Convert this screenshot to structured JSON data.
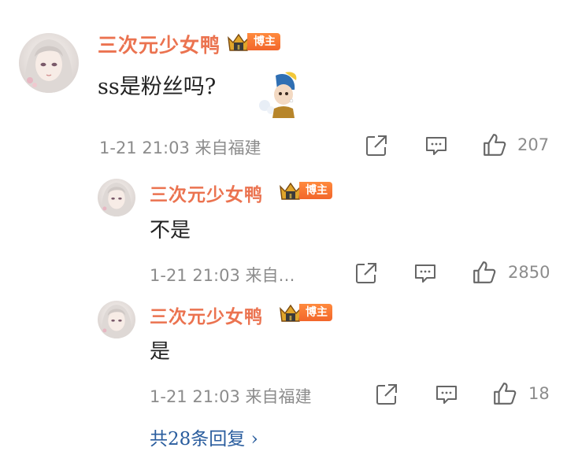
{
  "comments": [
    {
      "username": "三次元少女鸭",
      "badge": "博主",
      "text": "ss是粉丝吗?",
      "meta": "1-21 21:03 来自福建",
      "likes": "207",
      "sticker": "girl-with-pearl-earring-sticker"
    },
    {
      "username": "三次元少女鸭",
      "badge": "博主",
      "text": "不是",
      "meta": "1-21 21:03 来自…",
      "likes": "2850"
    },
    {
      "username": "三次元少女鸭",
      "badge": "博主",
      "text": "是",
      "meta": "1-21 21:03 来自福建",
      "likes": "18"
    }
  ],
  "more_replies": "共28条回复 ›",
  "colors": {
    "username": "#eb7350",
    "link": "#2a5d9e",
    "meta": "#8c8c8c",
    "badge": "#f2662b"
  },
  "icons": [
    "share-icon",
    "comment-icon",
    "like-icon",
    "crown-icon",
    "chevron-right-icon"
  ]
}
